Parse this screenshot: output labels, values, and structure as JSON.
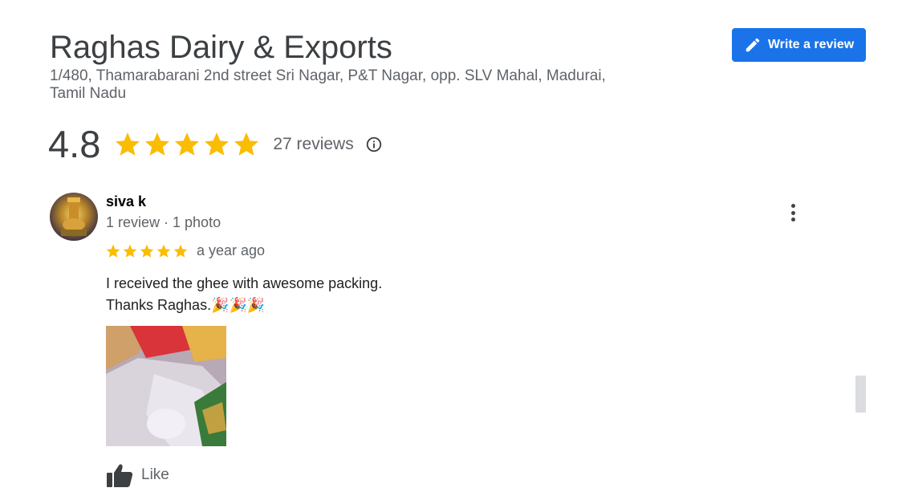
{
  "business": {
    "name": "Raghas Dairy & Exports",
    "address_line1": "1/480, Thamarabarani 2nd street Sri Nagar, P&T Nagar, opp. SLV Mahal, Madurai,",
    "address_line2": "Tamil Nadu"
  },
  "header": {
    "write_review_label": "Write a review",
    "write_review_icon": "pencil-icon"
  },
  "rating": {
    "value": "4.8",
    "stars": 5,
    "count_label": "27 reviews",
    "info_icon": "info-icon"
  },
  "review": {
    "author": "siva k",
    "meta": "1 review · 1 photo",
    "stars": 5,
    "time": "a year ago",
    "text_line1": "I received the ghee with awesome packing.",
    "text_line2": "Thanks Raghas.",
    "emoji": "🎉🎉🎉",
    "like_label": "Like",
    "like_icon": "thumbs-up-icon",
    "more_icon": "more-vertical-icon"
  },
  "colors": {
    "accent": "#1a73e8",
    "star": "#fbbc04",
    "muted_text": "#5f6368"
  }
}
